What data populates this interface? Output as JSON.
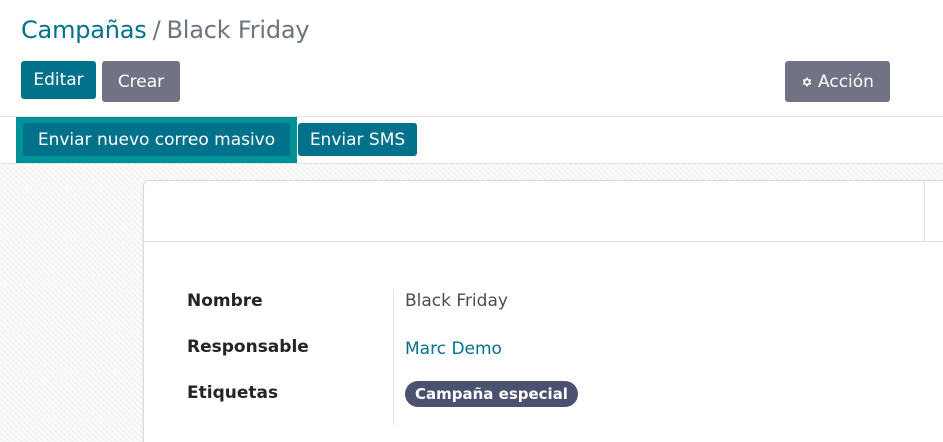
{
  "breadcrumb": {
    "parent": "Campañas",
    "separator": "/",
    "current": "Black Friday"
  },
  "toolbar": {
    "edit_label": "Editar",
    "create_label": "Crear",
    "action_label": "Acción",
    "action_icon": "gear-icon"
  },
  "header_buttons": {
    "mass_mail_label": "Enviar nuevo correo masivo",
    "sms_label": "Enviar SMS"
  },
  "form": {
    "fields": [
      {
        "label": "Nombre",
        "value": "Black Friday"
      },
      {
        "label": "Responsable",
        "value": "Marc Demo"
      },
      {
        "label": "Etiquetas",
        "value": "Campaña especial"
      }
    ]
  },
  "colors": {
    "primary": "#01718c",
    "secondary": "#707383",
    "highlight": "#019297",
    "tag": "#4a526f"
  }
}
